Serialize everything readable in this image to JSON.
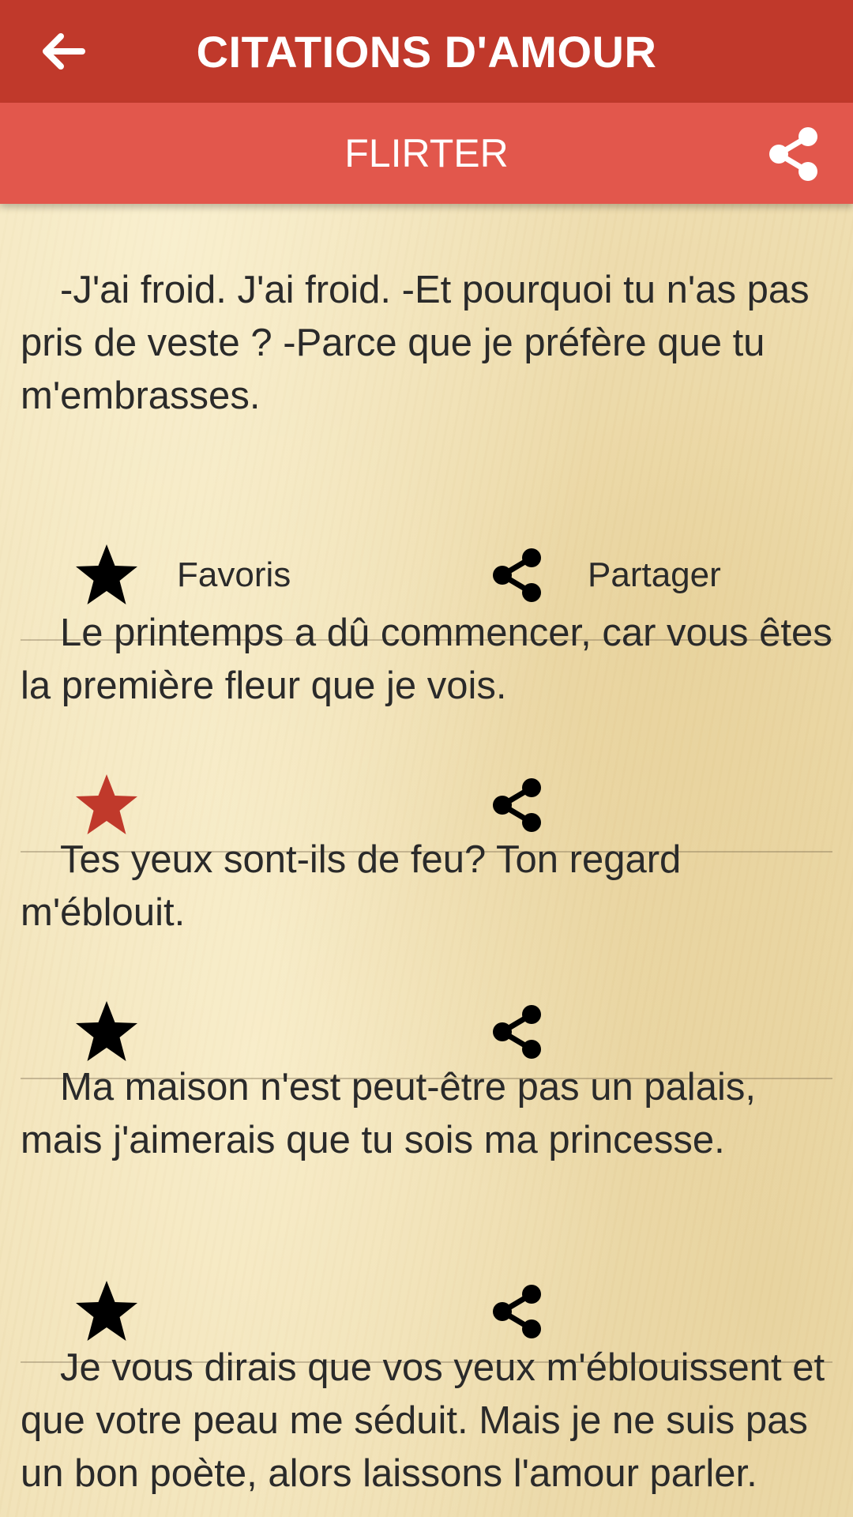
{
  "app_bar": {
    "title": "CITATIONS D'AMOUR",
    "back_icon": "arrow-left-icon"
  },
  "sub_bar": {
    "title": "FLIRTER",
    "share_icon": "share-icon"
  },
  "colors": {
    "app_bar": "#c0392b",
    "sub_bar": "#e2574c",
    "favorite_active": "#c0392b",
    "icon": "#000000"
  },
  "quotes": [
    {
      "text": "-J'ai froid. J'ai froid. -Et pourquoi tu n'as pas pris de veste ? -Parce que je préfère que tu m'embrasses.",
      "favorite_label": "Favoris",
      "share_label": "Partager",
      "favorited": false
    },
    {
      "text": "Le printemps a dû commencer, car vous êtes la première fleur que je vois.",
      "favorited": true
    },
    {
      "text": "Tes yeux sont-ils de feu? Ton regard m'éblouit.",
      "favorited": false
    },
    {
      "text": "Ma maison n'est peut-être pas un palais, mais j'aimerais que tu sois ma princesse.",
      "favorited": false
    },
    {
      "text": "Je vous dirais que vos yeux m'éblouissent et que votre peau me séduit. Mais je ne suis pas un bon poète, alors laissons l'amour parler.",
      "favorited": false
    }
  ]
}
